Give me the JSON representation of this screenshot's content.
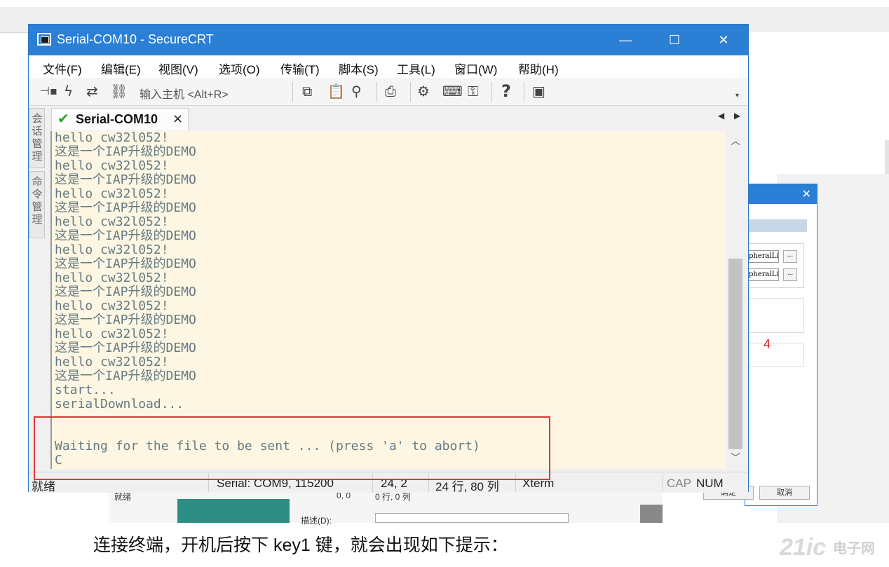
{
  "window": {
    "title": "Serial-COM10 - SecureCRT",
    "minimize": "—",
    "maximize": "☐",
    "close": "✕"
  },
  "menu": [
    "文件(F)",
    "编辑(E)",
    "视图(V)",
    "选项(O)",
    "传输(T)",
    "脚本(S)",
    "工具(L)",
    "窗口(W)",
    "帮助(H)"
  ],
  "toolbar": {
    "host_input_label": "输入主机 <Alt+R>",
    "icons": [
      "connect-icon",
      "lightning-icon",
      "reconnect-icon",
      "link-icon",
      "copy-icon",
      "paste-icon",
      "find-icon",
      "print-icon",
      "settings-icon",
      "keymap-icon",
      "key-icon",
      "help-icon",
      "sftp-icon"
    ]
  },
  "sidebar": {
    "session_manager": "会话管理",
    "command_manager": "命令管理"
  },
  "tab": {
    "label": "Serial-COM10",
    "close": "×",
    "nav_left": "◀",
    "nav_right": "▶"
  },
  "terminal": {
    "lines": [
      "hello cw32l052!",
      "这是一个IAP升级的DEMO",
      "hello cw32l052!",
      "这是一个IAP升级的DEMO",
      "hello cw32l052!",
      "这是一个IAP升级的DEMO",
      "hello cw32l052!",
      "这是一个IAP升级的DEMO",
      "hello cw32l052!",
      "这是一个IAP升级的DEMO",
      "hello cw32l052!",
      "这是一个IAP升级的DEMO",
      "hello cw32l052!",
      "这是一个IAP升级的DEMO",
      "hello cw32l052!",
      "这是一个IAP升级的DEMO",
      "hello cw32l052!",
      "这是一个IAP升级的DEMO",
      "start...",
      "serialDownload...",
      "",
      "",
      "Waiting for the file to be sent ... (press 'a' to abort)",
      "C"
    ]
  },
  "status": {
    "ready": "就绪",
    "connection": "Serial: COM9, 115200",
    "position": "24,  2",
    "size": "24 行, 80 列",
    "terminal_type": "Xterm",
    "cap": "CAP",
    "num": "NUM"
  },
  "background_dialog": {
    "close": "✕",
    "field1": "pheralLi",
    "field2": "pheralLi",
    "dots": "...",
    "number": "4",
    "ok": "确定",
    "cancel": "取消"
  },
  "background_window": {
    "status": "就绪",
    "pos": "0, 0",
    "size": "0 行, 0 列",
    "desc_label": "描述(D):"
  },
  "caption": "连接终端，开机后按下 key1 键，就会出现如下提示：",
  "watermark": {
    "main": "21ic",
    "sub": "电子网"
  },
  "accent_color": "#2b7fd4",
  "highlight_color": "#e53333",
  "terminal_bg": "#fdf6e3"
}
